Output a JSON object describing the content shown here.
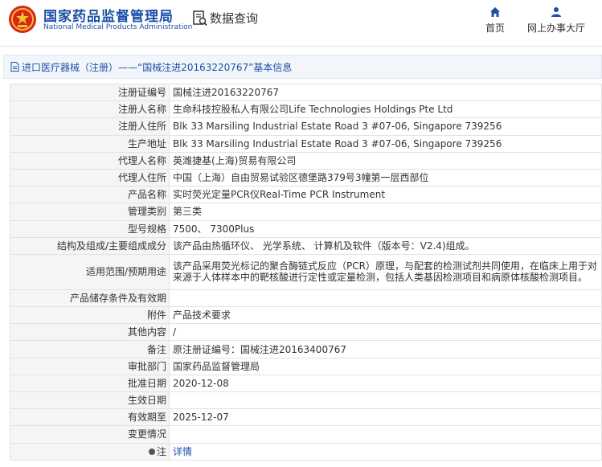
{
  "header": {
    "brand_cn": "国家药品监督管理局",
    "brand_en": "National Medical Products Administration",
    "query_label": "数据查询",
    "nav": [
      {
        "label": "首页",
        "icon": "home-icon"
      },
      {
        "label": "网上办事大厅",
        "icon": "user-icon"
      }
    ],
    "colors": {
      "brand": "#1d4fa8",
      "logo_red": "#d7261d",
      "logo_gold": "#f2c12e"
    }
  },
  "page_title": "进口医疗器械（注册）——“国械注进20163220767”基本信息",
  "fields": [
    {
      "key": "注册证编号",
      "value": "国械注进20163220767"
    },
    {
      "key": "注册人名称",
      "value": "生命科技控股私人有限公司Life Technologies Holdings Pte Ltd"
    },
    {
      "key": "注册人住所",
      "value": "Blk 33 Marsiling Industrial Estate Road 3 #07-06, Singapore 739256"
    },
    {
      "key": "生产地址",
      "value": "Blk 33 Marsiling Industrial Estate Road 3 #07-06, Singapore 739256"
    },
    {
      "key": "代理人名称",
      "value": "英潍捷基(上海)贸易有限公司"
    },
    {
      "key": "代理人住所",
      "value": "中国（上海）自由贸易试验区德堡路379号3幢第一层西部位"
    },
    {
      "key": "产品名称",
      "value": "实时荧光定量PCR仪Real-Time PCR Instrument"
    },
    {
      "key": "管理类别",
      "value": "第三类"
    },
    {
      "key": "型号规格",
      "value": "7500、 7300Plus"
    },
    {
      "key": "结构及组成/主要组成成分",
      "value": "该产品由热循环仪、 光学系统、 计算机及软件（版本号：V2.4)组成。"
    },
    {
      "key": "适用范围/预期用途",
      "value": "该产品采用荧光标记的聚合酶链式反应（PCR）原理，与配套的检测试剂共同使用，在临床上用于对来源于人体样本中的靶核酸进行定性或定量检测，包括人类基因检测项目和病原体核酸检测项目。"
    },
    {
      "key": "产品储存条件及有效期",
      "value": ""
    },
    {
      "key": "附件",
      "value": "产品技术要求"
    },
    {
      "key": "其他内容",
      "value": "/"
    },
    {
      "key": "备注",
      "value": "原注册证编号：国械注进20163400767"
    },
    {
      "key": "审批部门",
      "value": "国家药品监督管理局"
    },
    {
      "key": "批准日期",
      "value": "2020-12-08"
    },
    {
      "key": "生效日期",
      "value": ""
    },
    {
      "key": "有效期至",
      "value": "2025-12-07"
    },
    {
      "key": "变更情况",
      "value": ""
    },
    {
      "key": "注",
      "value": "详情"
    }
  ]
}
